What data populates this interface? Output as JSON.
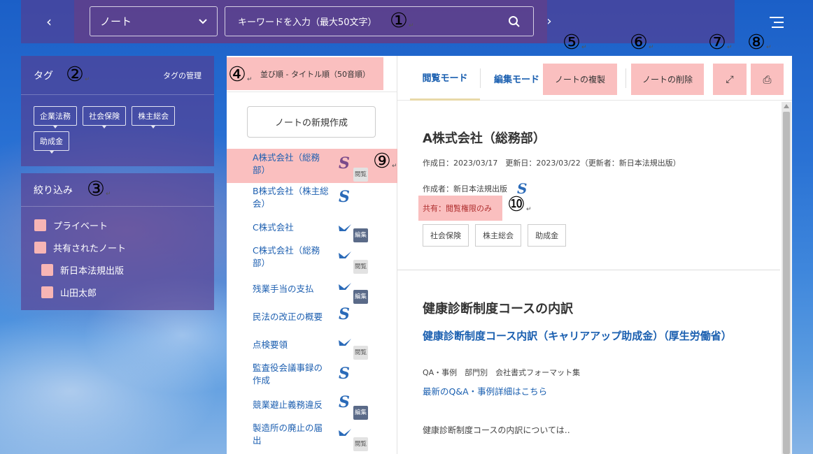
{
  "topbar": {
    "prev_label": "‹",
    "next_label": "›",
    "category_value": "ノート",
    "search_placeholder": "キーワードを入力（最大50文字）",
    "marker": "①"
  },
  "tags_panel": {
    "title": "タグ",
    "manage_label": "タグの管理",
    "marker": "②",
    "tags": [
      "企業法務",
      "社会保険",
      "株主総会",
      "助成金"
    ]
  },
  "filter_panel": {
    "title": "絞り込み",
    "marker": "③",
    "items": [
      "プライベート",
      "共有されたノート",
      "新日本法規出版",
      "山田太郎"
    ]
  },
  "list": {
    "marker": "④",
    "sort_label": "並び順 - タイトル順（50音順）",
    "new_note_label": "ノートの新規作成",
    "selected_marker": "⑨",
    "notes": [
      {
        "title": "A株式会社（総務部）",
        "badge": "閲覧"
      },
      {
        "title": "B株式会社（株主総会）",
        "badge": ""
      },
      {
        "title": "C株式会社",
        "badge": "編集"
      },
      {
        "title": "C株式会社（総務部）",
        "badge": "閲覧"
      },
      {
        "title": "残業手当の支払",
        "badge": "編集"
      },
      {
        "title": "民法の改正の概要",
        "badge": ""
      },
      {
        "title": "点検要領",
        "badge": "閲覧"
      },
      {
        "title": "監査役会議事録の作成",
        "badge": ""
      },
      {
        "title": "競業避止義務違反",
        "badge": "編集"
      },
      {
        "title": "製造所の廃止の届出",
        "badge": "閲覧"
      }
    ]
  },
  "detail": {
    "tab_view": "閲覧モード",
    "tab_edit": "編集モード",
    "copy_label": "ノートの複製",
    "delete_label": "ノートの削除",
    "expand_icon": "⤢",
    "print_icon": "⎙",
    "markers": {
      "copy": "⑤",
      "delete": "⑥",
      "expand": "⑦",
      "print": "⑧",
      "share": "⑩"
    },
    "title": "A株式会社（総務部）",
    "dates": "作成日：2023/03/17　更新日：2023/03/22（更新者：新日本法規出版）",
    "author": "作成者：新日本法規出版",
    "share": "共有：閲覧権限のみ",
    "tags": [
      "社会保険",
      "株主総会",
      "助成金"
    ],
    "section_title": "健康診断制度コースの内訳",
    "link_title": "健康診断制度コース内訳（キャリアアップ助成金）（厚生労働省）",
    "meta": "QA・事例　部門別　会社書式フォーマット集",
    "qa_link": "最新のQ&A・事例詳細はこちら",
    "body_text": "健康診断制度コースの内訳については‥"
  }
}
